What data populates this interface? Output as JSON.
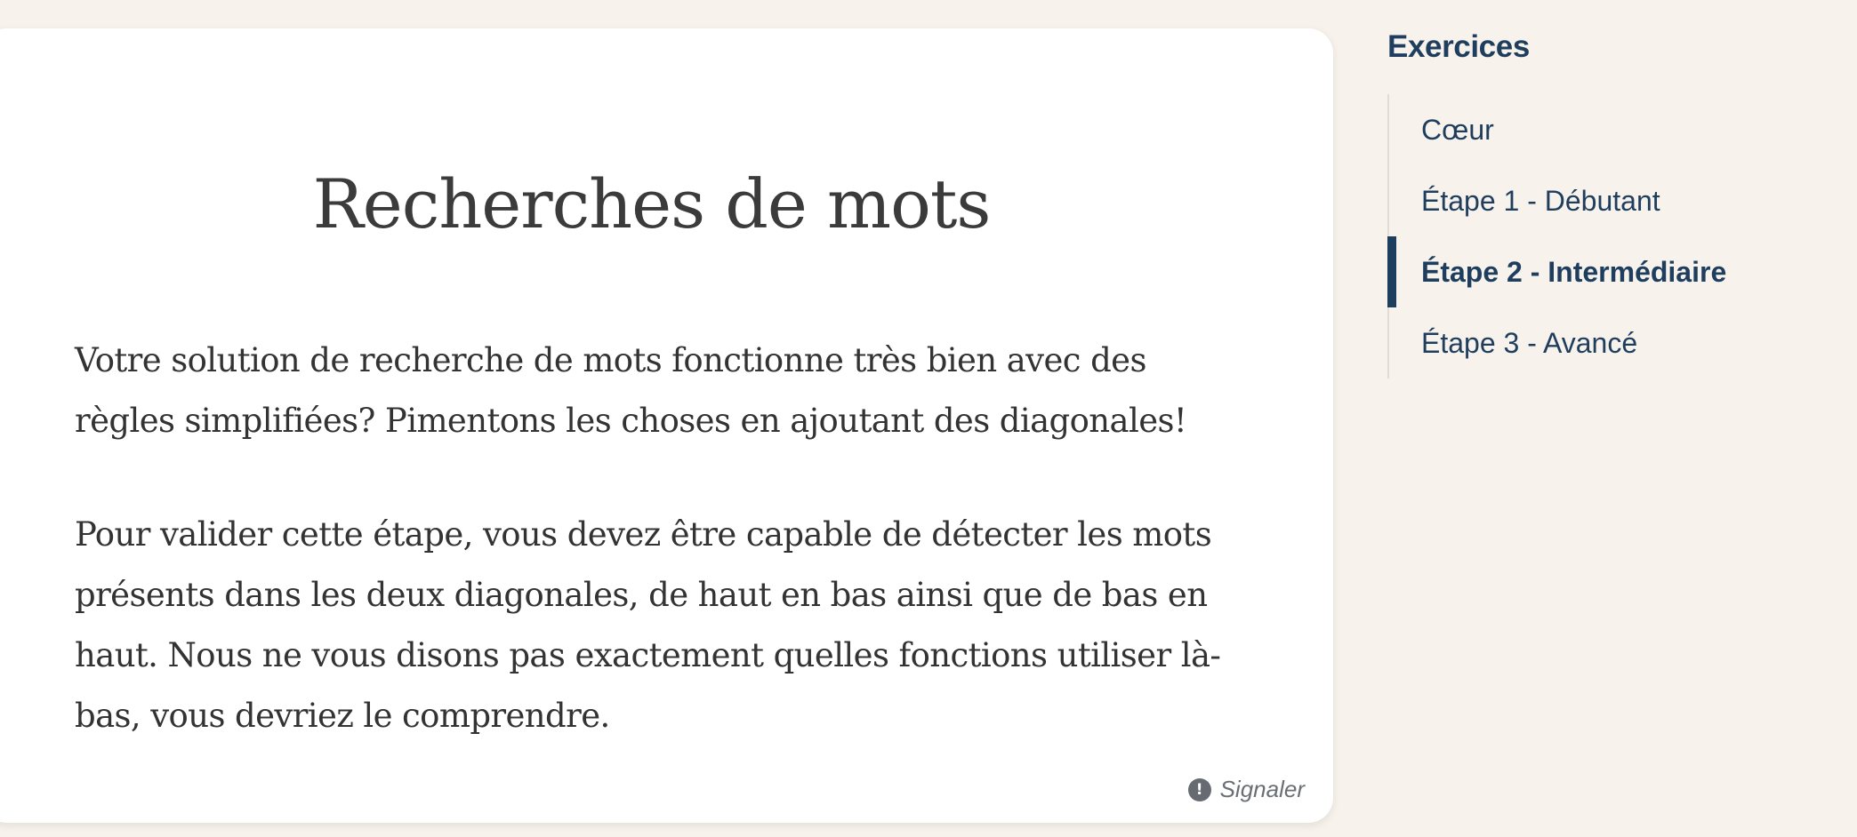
{
  "main": {
    "title": "Recherches de mots",
    "paragraphs": [
      "Votre solution de recherche de mots fonctionne très bien avec des règles simplifiées? Pimentons les choses en ajoutant des diagonales!",
      "Pour valider cette étape, vous devez être capable de détecter les mots présents dans les deux diagonales, de haut en bas ainsi que de bas en haut. Nous ne vous disons pas exactement quelles fonctions utiliser là-bas, vous devriez le comprendre."
    ],
    "report": {
      "icon": "exclamation-circle-icon",
      "icon_glyph": "!",
      "label": "Signaler"
    }
  },
  "sidebar": {
    "title": "Exercices",
    "items": [
      {
        "label": "Cœur",
        "active": false
      },
      {
        "label": "Étape 1 - Débutant",
        "active": false
      },
      {
        "label": "Étape 2 - Intermédiaire",
        "active": true
      },
      {
        "label": "Étape 3 - Avancé",
        "active": false
      }
    ]
  },
  "colors": {
    "background": "#f7f3ec",
    "card": "#ffffff",
    "accent": "#1f3e5e",
    "text": "#333333"
  }
}
